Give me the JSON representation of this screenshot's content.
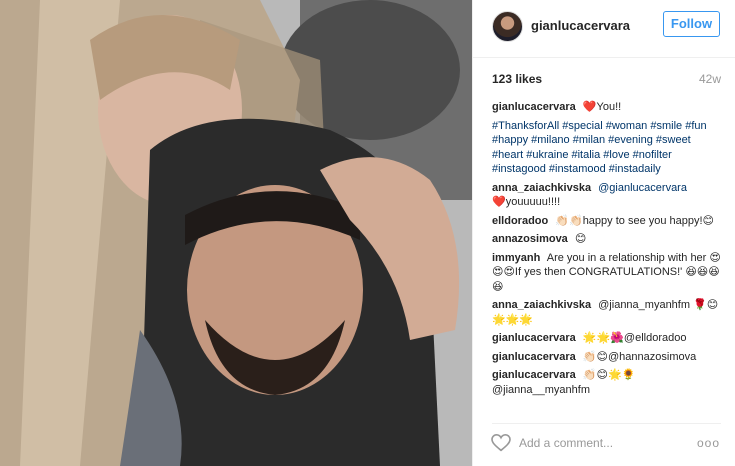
{
  "post": {
    "image_alt": "Selfie of a couple outdoors",
    "author": "gianlucacervara",
    "follow_label": "Follow",
    "likes": "123 likes",
    "time": "42w"
  },
  "comments": [
    {
      "author": "gianlucacervara",
      "text": "❤️You!!"
    },
    {
      "author": "",
      "text": "#ThanksforAll #special #woman #smile #fun #happy #milano #milan #evening #sweet #heart #ukraine #italia #love #nofilter #instagood #instamood #instadaily",
      "is_tags": true
    },
    {
      "author": "anna_zaiachkivska",
      "text": "@gianlucacervara",
      "is_mention": true
    },
    {
      "author": "",
      "text": "❤️youuuuu!!!!"
    },
    {
      "author": "elldoradoo",
      "text": "👏🏻👏🏻happy to see you happy!😊"
    },
    {
      "author": "annazosimova",
      "text": "😊"
    },
    {
      "author": "immyanh",
      "text": "Are you in a relationship with her 😍😍😍If yes then CONGRATULATIONS!' 😆😆😆😆"
    },
    {
      "author": "anna_zaiachkivska",
      "text": "@jianna_myanhfm 🌹😊🌟🌟🌟"
    },
    {
      "author": "gianlucacervara",
      "text": "🌟🌟🌺@elldoradoo"
    },
    {
      "author": "gianlucacervara",
      "text": "👏🏻😊@hannazosimova"
    },
    {
      "author": "gianlucacervara",
      "text": "👏🏻😊🌟🌻 @jianna__myanhfm"
    }
  ],
  "footer": {
    "comment_placeholder": "Add a comment...",
    "more_label": "ooo"
  },
  "icons": {
    "like": "heart-icon",
    "more": "more-options-icon"
  }
}
